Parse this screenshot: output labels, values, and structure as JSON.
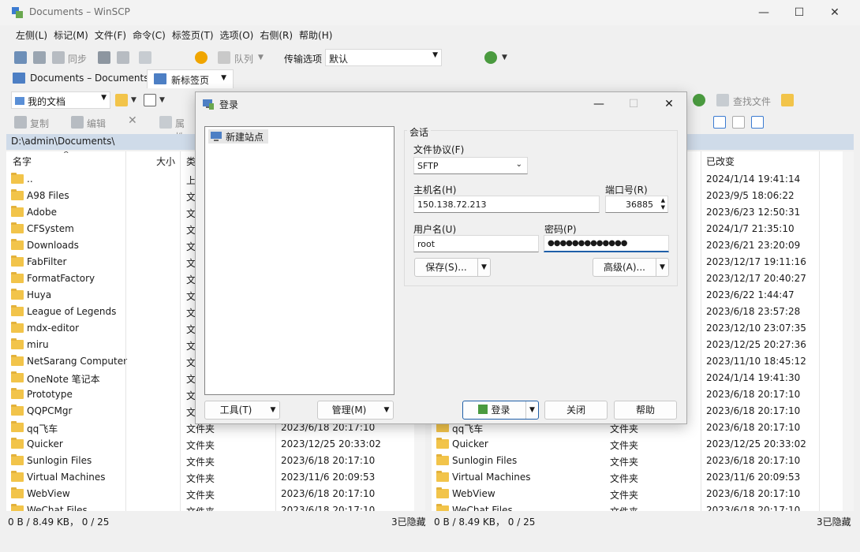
{
  "window": {
    "title": "Documents – WinSCP"
  },
  "menu": [
    "左侧(L)",
    "标记(M)",
    "文件(F)",
    "命令(C)",
    "标签页(T)",
    "选项(O)",
    "右侧(R)",
    "帮助(H)"
  ],
  "toolbar": {
    "sync": "同步",
    "queue": "队列",
    "transfer_label": "传输选项",
    "transfer_value": "默认"
  },
  "tabs": {
    "tab1": "Documents – Documents",
    "tab2": "新标签页"
  },
  "left_pane": {
    "location": "我的文档",
    "copy": "复制",
    "edit": "编辑",
    "props": "属性",
    "path": "D:\\admin\\Documents\\",
    "headers": {
      "name": "名字",
      "size": "大小",
      "type": "类"
    },
    "status_left": "0 B / 8.49 KB， 0 / 25",
    "status_right": "3已隐藏"
  },
  "right_pane": {
    "find_files": "查找文件",
    "header_changed": "已改变",
    "status_left": "0 B / 8.49 KB， 0 / 25",
    "status_right": "3已隐藏"
  },
  "files": [
    {
      "name": "..",
      "type_l": "上",
      "date": "2024/1/14 19:41:14"
    },
    {
      "name": "A98 Files",
      "type_l": "文",
      "date": "2023/9/5 18:06:22"
    },
    {
      "name": "Adobe",
      "type_l": "文",
      "date": "2023/6/23 12:50:31"
    },
    {
      "name": "CFSystem",
      "type_l": "文",
      "date": "2024/1/7 21:35:10"
    },
    {
      "name": "Downloads",
      "type_l": "文",
      "date": "2023/6/21 23:20:09"
    },
    {
      "name": "FabFilter",
      "type_l": "文",
      "date": "2023/12/17 19:11:16"
    },
    {
      "name": "FormatFactory",
      "type_l": "文",
      "date": "2023/12/17 20:40:27"
    },
    {
      "name": "Huya",
      "type_l": "文",
      "date": "2023/6/22 1:44:47"
    },
    {
      "name": "League of Legends",
      "type_l": "文",
      "date": "2023/6/18 23:57:28"
    },
    {
      "name": "mdx-editor",
      "type_l": "文",
      "date": "2023/12/10 23:07:35"
    },
    {
      "name": "miru",
      "type_l": "文",
      "date": "2023/12/25 20:27:36"
    },
    {
      "name": "NetSarang Computer",
      "type_l": "文",
      "date": "2023/11/10 18:45:12"
    },
    {
      "name": "OneNote 笔记本",
      "type_l": "文",
      "date": "2024/1/14 19:41:30"
    },
    {
      "name": "Prototype",
      "type_l": "文",
      "date": "2023/6/18 20:17:10"
    },
    {
      "name": "QQPCMgr",
      "type_l": "文",
      "date": "2023/6/18 20:17:10"
    }
  ],
  "files_full": [
    {
      "name": "qq飞车",
      "type": "文件夹",
      "date": "2023/6/18 20:17:10"
    },
    {
      "name": "Quicker",
      "type": "文件夹",
      "date": "2023/12/25 20:33:02"
    },
    {
      "name": "Sunlogin Files",
      "type": "文件夹",
      "date": "2023/6/18 20:17:10"
    },
    {
      "name": "Virtual Machines",
      "type": "文件夹",
      "date": "2023/11/6 20:09:53"
    },
    {
      "name": "WebView",
      "type": "文件夹",
      "date": "2023/6/18 20:17:10"
    },
    {
      "name": "WeChat Files",
      "type": "文件夹",
      "date": "2023/6/18 20:17:10"
    }
  ],
  "dialog": {
    "title": "登录",
    "site": "新建站点",
    "group": "会话",
    "protocol_label": "文件协议(F)",
    "protocol_value": "SFTP",
    "host_label": "主机名(H)",
    "host_value": "150.138.72.213",
    "port_label": "端口号(R)",
    "port_value": "36885",
    "user_label": "用户名(U)",
    "user_value": "root",
    "pass_label": "密码(P)",
    "pass_value": "●●●●●●●●●●●●●",
    "save": "保存(S)...",
    "advanced": "高级(A)...",
    "tools": "工具(T)",
    "manage": "管理(M)",
    "login": "登录",
    "close": "关闭",
    "help": "帮助"
  }
}
